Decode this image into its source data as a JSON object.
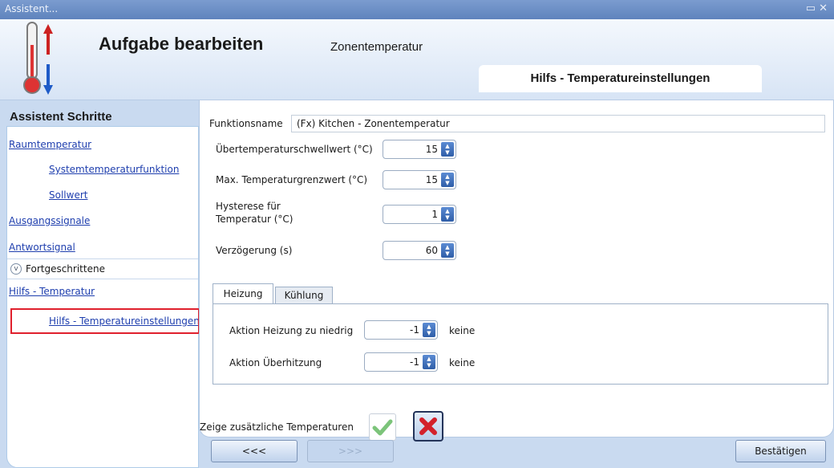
{
  "window": {
    "title": "Assistent..."
  },
  "header": {
    "title": "Aufgabe bearbeiten",
    "subtitle": "Zonentemperatur",
    "tab": "Hilfs - Temperatureinstellungen"
  },
  "sidebar": {
    "title": "Assistent Schritte",
    "items": [
      {
        "label": "Raumtemperatur"
      },
      {
        "label": "Systemtemperaturfunktion"
      },
      {
        "label": "Sollwert"
      },
      {
        "label": "Ausgangssignale"
      },
      {
        "label": "Antwortsignal"
      },
      {
        "label": "Fortgeschrittene"
      },
      {
        "label": "Hilfs - Temperatur"
      },
      {
        "label": "Hilfs - Temperatureinstellungen"
      }
    ]
  },
  "form": {
    "function_name_label": "Funktionsname",
    "function_name_value": "(Fx) Kitchen - Zonentemperatur",
    "fields": [
      {
        "label": "Übertemperaturschwellwert (°C)",
        "value": "15"
      },
      {
        "label": "Max. Temperaturgrenzwert (°C)",
        "value": "15"
      },
      {
        "label_line1": "Hysterese für",
        "label_line2": "Temperatur (°C)",
        "value": "1"
      },
      {
        "label": "Verzögerung (s)",
        "value": "60"
      }
    ],
    "tabs": [
      {
        "label": "Heizung"
      },
      {
        "label": "Kühlung"
      }
    ],
    "actions": [
      {
        "label": "Aktion Heizung zu niedrig",
        "value": "-1",
        "text": "keine"
      },
      {
        "label": "Aktion Überhitzung",
        "value": "-1",
        "text": "keine"
      }
    ],
    "show_additional_label": "Zeige zusätzliche Temperaturen"
  },
  "footer": {
    "back_label": "<<<",
    "next_label": ">>>",
    "confirm_label": "Bestätigen"
  },
  "colors": {
    "link": "#1f3fae",
    "selection": "#e0202d",
    "accent": "#2f5ea8"
  }
}
